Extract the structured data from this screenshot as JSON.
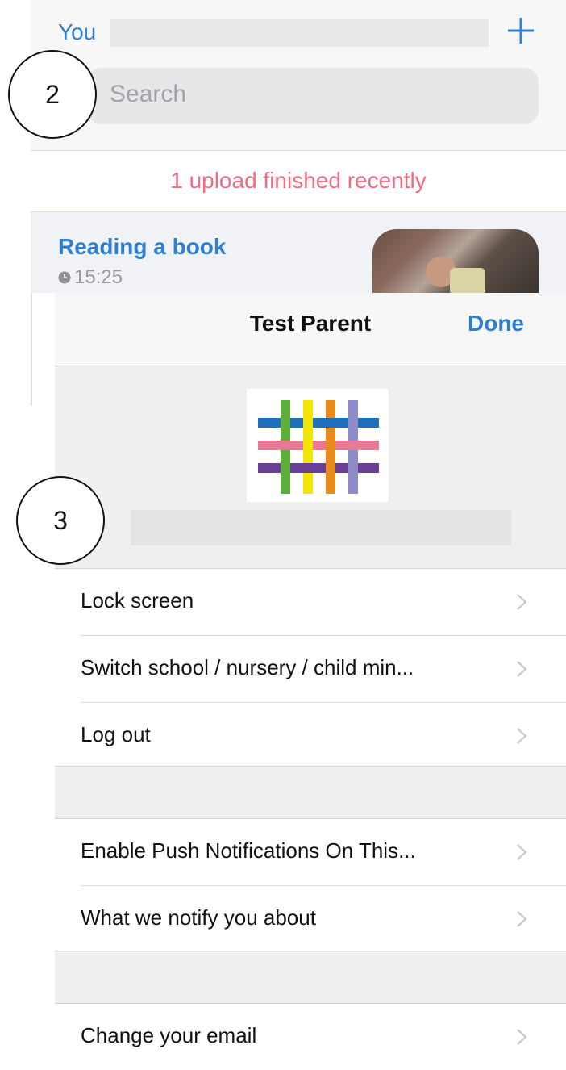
{
  "header": {
    "you_label": "You",
    "search_placeholder": "Search"
  },
  "annotations": {
    "callout_search": "2",
    "callout_profile": "3"
  },
  "feed": {
    "upload_status": "1 upload finished recently",
    "entry": {
      "title": "Reading a book",
      "time": "15:25"
    }
  },
  "sheet": {
    "title": "Test Parent",
    "done_label": "Done",
    "group1": [
      {
        "label": "Lock screen"
      },
      {
        "label": "Switch school / nursery / child min..."
      },
      {
        "label": "Log out"
      }
    ],
    "group2": [
      {
        "label": "Enable Push Notifications On This..."
      },
      {
        "label": "What we notify you about"
      }
    ],
    "group3": [
      {
        "label": "Change your email"
      }
    ]
  },
  "colors": {
    "accent_blue": "#2f7fd0",
    "upload_pink": "#f06b84",
    "logo_stripes": [
      "#1f6fbf",
      "#5fae3c",
      "#f2e600",
      "#e98a1c",
      "#e77a94",
      "#6a3d96",
      "#8e8cc8"
    ]
  }
}
